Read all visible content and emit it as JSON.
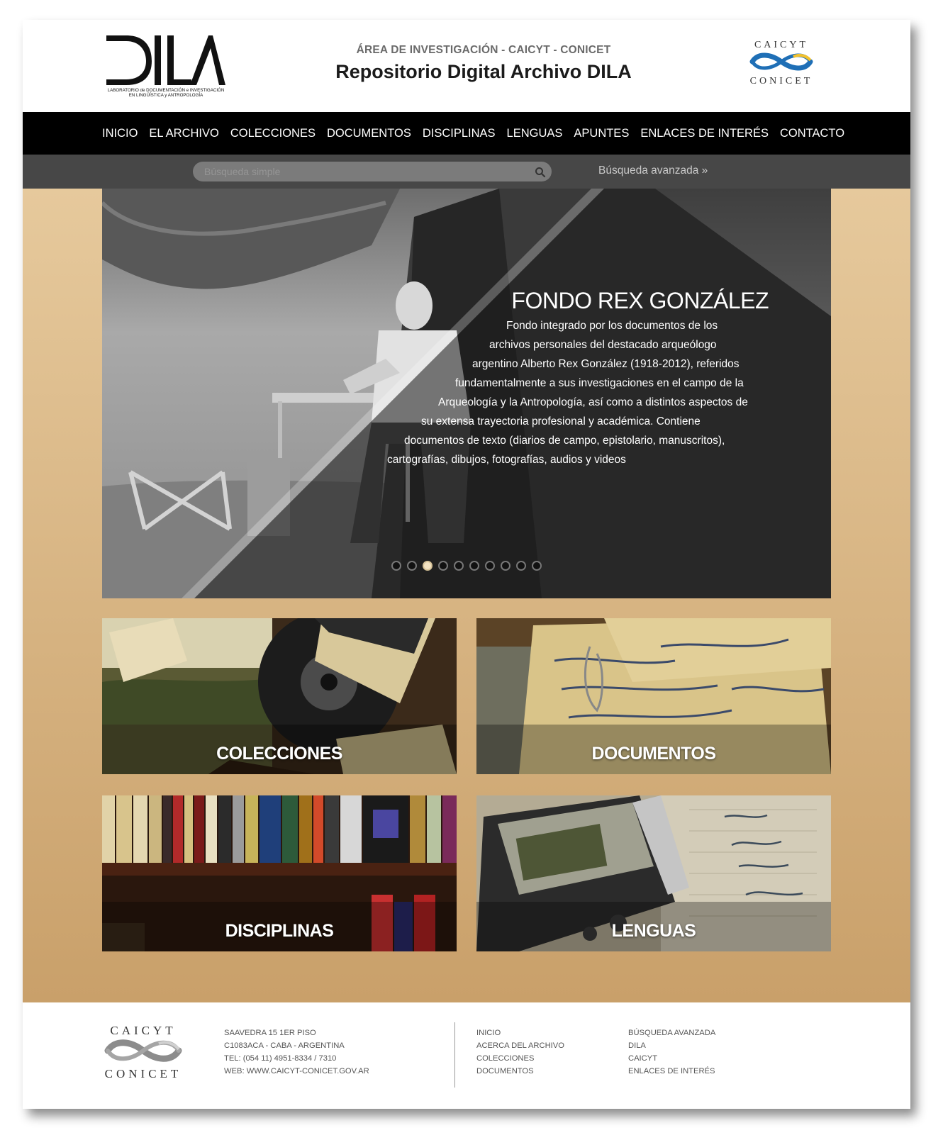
{
  "header": {
    "logo_text": "DILA",
    "logo_subtitle_line1": "LABORATORIO de DOCUMENTACIÓN e INVESTIGACIÓN",
    "logo_subtitle_line2": "EN LINGÜÍSTICA y ANTROPOLOGÍA",
    "area": "ÁREA DE INVESTIGACIÓN - CAICYT - CONICET",
    "title": "Repositorio Digital Archivo DILA",
    "partner_top": "CAICYT",
    "partner_bottom": "CONICET"
  },
  "nav": {
    "items": [
      "INICIO",
      "EL ARCHIVO",
      "COLECCIONES",
      "DOCUMENTOS",
      "DISCIPLINAS",
      "LENGUAS",
      "APUNTES",
      "ENLACES DE INTERÉS",
      "CONTACTO"
    ]
  },
  "search": {
    "placeholder": "Búsqueda simple",
    "advanced_label": "Búsqueda avanzada  »"
  },
  "slider": {
    "title": "FONDO REX GONZÁLEZ",
    "lines": [
      "Fondo integrado por los documentos de los",
      "archivos personales del destacado arqueólogo",
      "argentino Alberto Rex González (1918-2012), referidos",
      "fundamentalmente a sus investigaciones en el campo de la",
      "Arqueología y la Antropología, así como a distintos aspectos de",
      "su extensa trayectoria profesional y académica. Contiene",
      "documentos de texto (diarios de campo, epistolario, manuscritos),",
      "cartografías, dibujos, fotografías, audios y videos"
    ],
    "dot_count": 10,
    "active_index": 2
  },
  "tiles": [
    {
      "label": "COLECCIONES"
    },
    {
      "label": "DOCUMENTOS"
    },
    {
      "label": "DISCIPLINAS"
    },
    {
      "label": "LENGUAS"
    }
  ],
  "footer": {
    "logo_top": "CAICYT",
    "logo_bottom": "CONICET",
    "address": [
      "SAAVEDRA 15 1ER PISO",
      "C1083ACA - CABA - ARGENTINA",
      "TEL: (054 11) 4951-8334 / 7310",
      "WEB: WWW.CAICYT-CONICET.GOV.AR"
    ],
    "links_col1": [
      "INICIO",
      "ACERCA DEL ARCHIVO",
      "COLECCIONES",
      "DOCUMENTOS"
    ],
    "links_col2": [
      "BÚSQUEDA AVANZADA",
      "DILA",
      "CAICYT",
      "ENLACES DE INTERÉS"
    ]
  },
  "colors": {
    "nav_bg": "#000000",
    "search_bar_bg": "#474747",
    "main_gradient_top": "#e6c99c",
    "main_gradient_bottom": "#c9a06a",
    "caicyt_blue": "#1f6fb6"
  }
}
